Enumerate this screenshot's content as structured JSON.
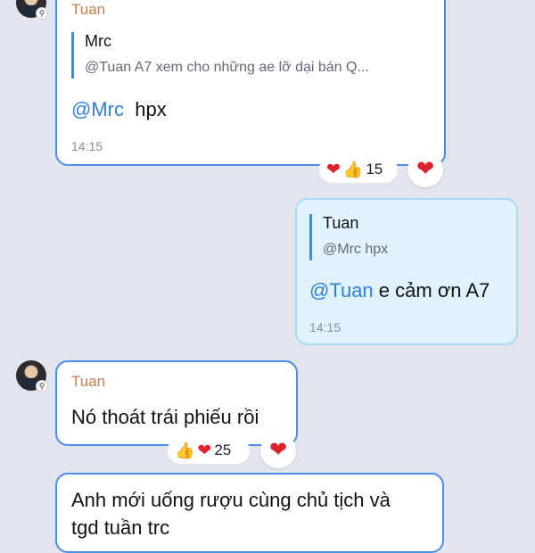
{
  "messages": [
    {
      "sender": "Tuan",
      "quote_name": "Mrc",
      "quote_text": "@Tuan A7 xem cho những ae lỡ dại bán Q...",
      "mention": "@Mrc",
      "text": "hpx",
      "time": "14:15",
      "reaction_count": "15",
      "reaction_icons": [
        "heart-icon",
        "thumbs-up-icon"
      ]
    },
    {
      "sender": "Tuan",
      "quote_name": "Tuan",
      "quote_text": "@Mrc  hpx",
      "mention": "@Tuan",
      "text": "e cảm ơn A7",
      "time": "14:15"
    },
    {
      "sender": "Tuan",
      "text": "Nó thoát trái phiếu rồi",
      "reaction_count": "25",
      "reaction_icons": [
        "thumbs-up-icon",
        "heart-icon"
      ]
    },
    {
      "text_line1": "Anh mới uống rượu cùng chủ tịch và",
      "text_line2": "tgd tuần trc"
    }
  ],
  "colors": {
    "background": "#e2e5ed",
    "bubble_border": "#4a8ee8",
    "my_bubble": "#dff2fd",
    "mention": "#2d7fd8",
    "sender": "#c97c4a",
    "heart": "#e0202b"
  }
}
